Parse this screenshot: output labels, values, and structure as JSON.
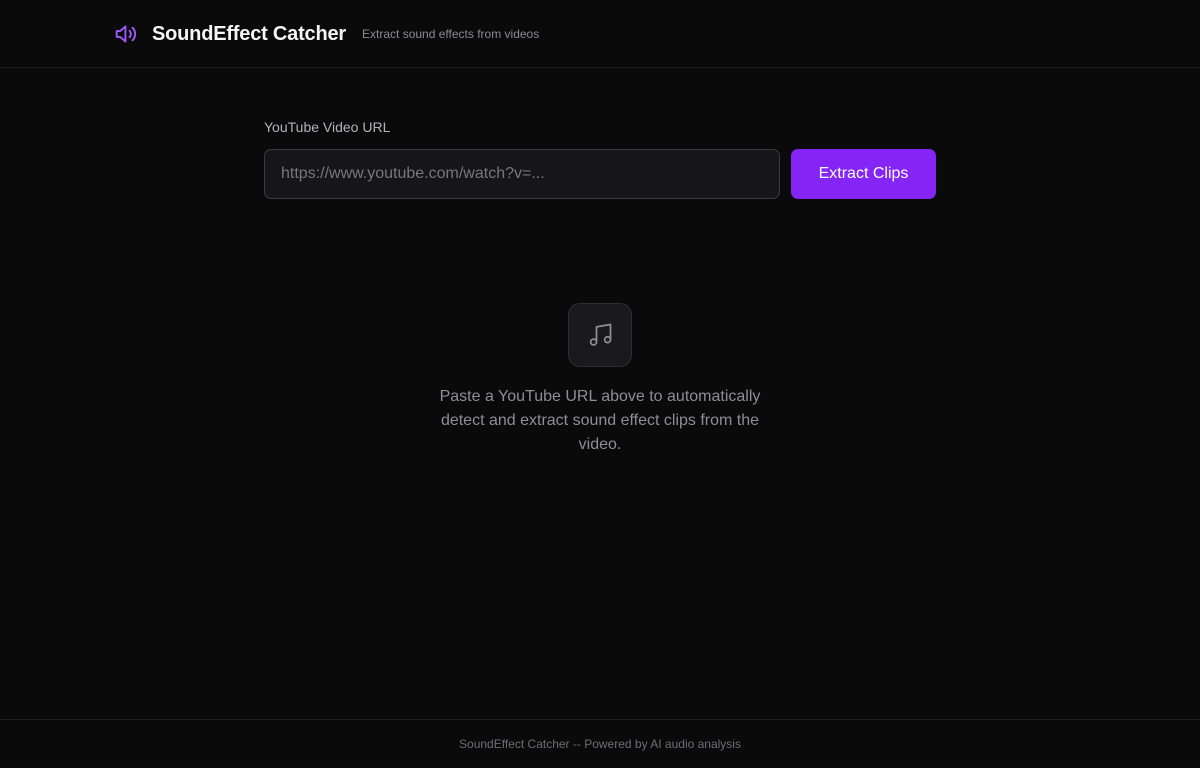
{
  "header": {
    "title": "SoundEffect Catcher",
    "tagline": "Extract sound effects from videos",
    "icon": "speaker-icon",
    "accent_color": "#a259ff"
  },
  "form": {
    "label": "YouTube Video URL",
    "url_value": "",
    "url_placeholder": "https://www.youtube.com/watch?v=...",
    "submit_label": "Extract Clips",
    "button_color": "#8424f5"
  },
  "empty_state": {
    "icon": "music-note-icon",
    "message": "Paste a YouTube URL above to automatically detect and extract sound effect clips from the video."
  },
  "footer": {
    "text": "SoundEffect Catcher -- Powered by AI audio analysis"
  }
}
